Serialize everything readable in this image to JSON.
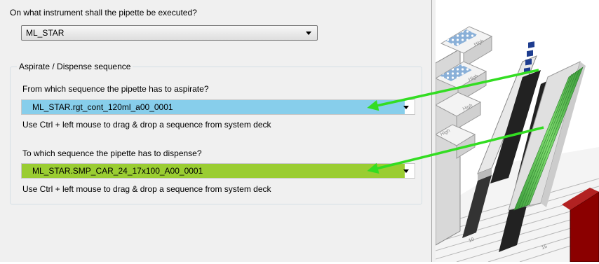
{
  "instrument": {
    "question": "On what instrument shall the pipette be executed?",
    "selected": "ML_STAR"
  },
  "sequence_group": {
    "title": "Aspirate / Dispense sequence",
    "aspirate": {
      "question": "From which sequence the pipette has to aspirate?",
      "value": "ML_STAR.rgt_cont_120ml_a00_0001",
      "hint": "Use Ctrl + left mouse to drag & drop a sequence from system deck",
      "color": "#87ceeb"
    },
    "dispense": {
      "question": "To which sequence the pipette has to dispense?",
      "value": "ML_STAR.SMP_CAR_24_17x100_A00_0001",
      "hint": "Use Ctrl + left mouse to drag & drop a sequence from system deck",
      "color": "#9acd32"
    }
  },
  "deck": {
    "carrier_labels": [
      "High",
      "High",
      "High",
      "High"
    ],
    "position_numbers": [
      "10",
      "15"
    ],
    "arrow_color": "#33dd22"
  }
}
